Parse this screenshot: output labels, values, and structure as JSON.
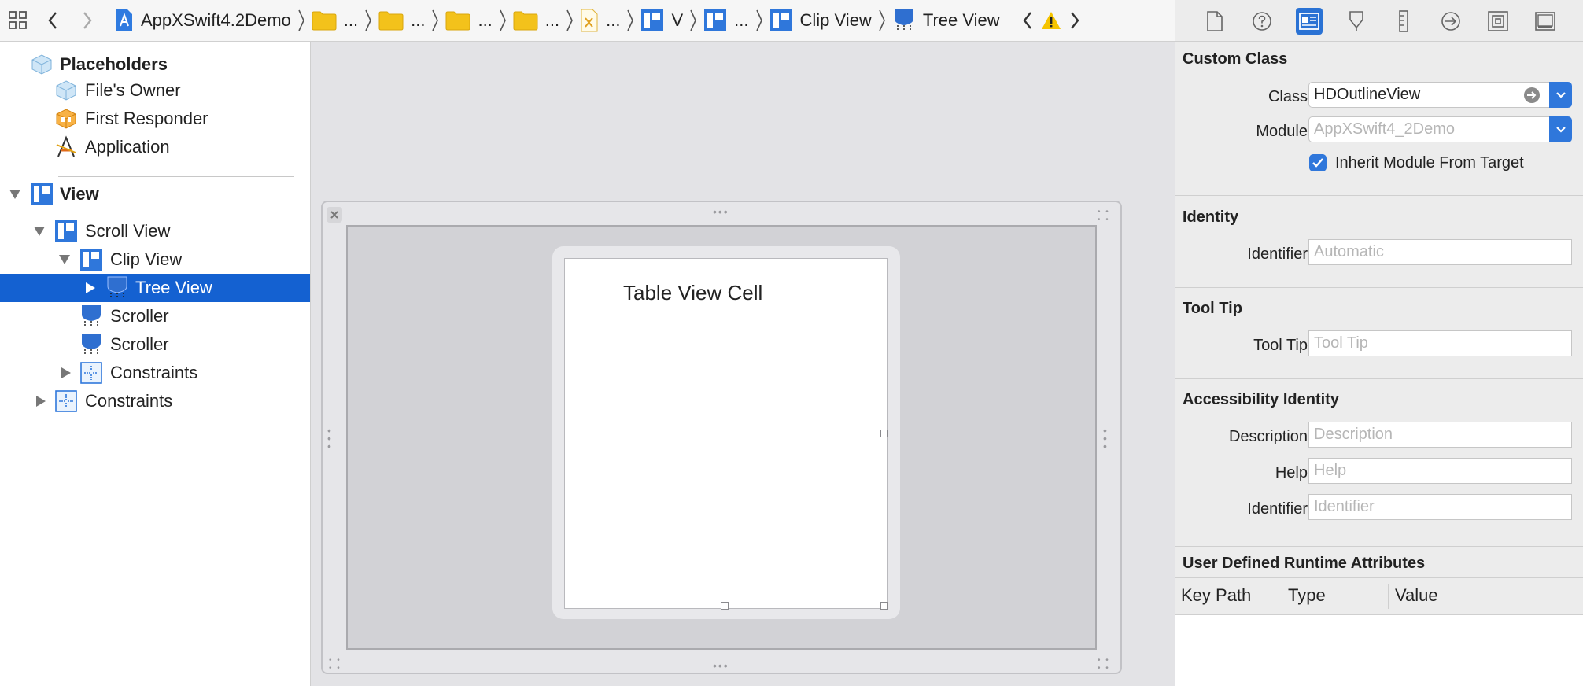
{
  "jumpbar": {
    "crumbs": [
      {
        "label": "AppXSwift4.2Demo",
        "icon": "blueprint-document-icon"
      },
      {
        "label": "...",
        "icon": "folder-icon"
      },
      {
        "label": "...",
        "icon": "folder-icon"
      },
      {
        "label": "...",
        "icon": "folder-icon"
      },
      {
        "label": "...",
        "icon": "folder-icon"
      },
      {
        "label": "...",
        "icon": "xib-file-icon"
      },
      {
        "label": "V",
        "icon": "view-icon"
      },
      {
        "label": "...",
        "icon": "view-icon"
      },
      {
        "label": "Clip View",
        "icon": "view-icon"
      },
      {
        "label": "Tree View",
        "icon": "outline-view-icon"
      }
    ]
  },
  "outline": {
    "placeholders": "Placeholders",
    "files_owner": "File's Owner",
    "first_responder": "First Responder",
    "application": "Application",
    "view": "View",
    "scroll_view": "Scroll View",
    "clip_view": "Clip View",
    "tree_view": "Tree View",
    "scroller1": "Scroller",
    "scroller2": "Scroller",
    "constraints_inner": "Constraints",
    "constraints_outer": "Constraints"
  },
  "canvas": {
    "cell_text": "Table View Cell"
  },
  "inspector": {
    "custom_class": {
      "title": "Custom Class",
      "class_label": "Class",
      "class_value": "HDOutlineView",
      "module_label": "Module",
      "module_placeholder": "AppXSwift4_2Demo",
      "inherit_label": "Inherit Module From Target",
      "inherit_checked": true
    },
    "identity": {
      "title": "Identity",
      "identifier_label": "Identifier",
      "identifier_placeholder": "Automatic"
    },
    "tooltip": {
      "title": "Tool Tip",
      "label": "Tool Tip",
      "placeholder": "Tool Tip"
    },
    "accessibility": {
      "title": "Accessibility Identity",
      "description_label": "Description",
      "description_placeholder": "Description",
      "help_label": "Help",
      "help_placeholder": "Help",
      "identifier_label": "Identifier",
      "identifier_placeholder": "Identifier"
    },
    "runtime_attrs": {
      "title": "User Defined Runtime Attributes",
      "columns": [
        "Key Path",
        "Type",
        "Value"
      ]
    }
  },
  "colors": {
    "selection": "#1461d1",
    "accent": "#2f77db",
    "canvas_bg": "#e3e3e6",
    "warning": "#f5c400"
  }
}
